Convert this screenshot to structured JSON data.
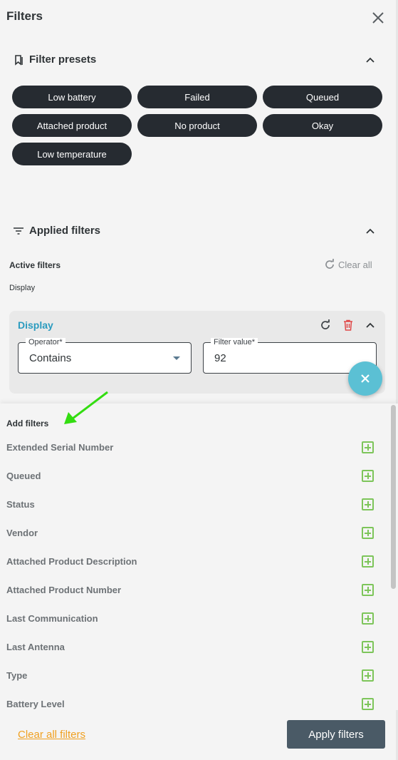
{
  "header": {
    "title": "Filters",
    "close_icon": "close-icon"
  },
  "presets": {
    "title": "Filter presets",
    "chips": [
      "Low battery",
      "Failed",
      "Queued",
      "Attached product",
      "No product",
      "Okay",
      "Low temperature"
    ]
  },
  "applied": {
    "title": "Applied filters",
    "active_label": "Active filters",
    "clear_all": "Clear all",
    "active_field": "Display",
    "card": {
      "title": "Display",
      "operator_label": "Operator*",
      "operator_value": "Contains",
      "value_label": "Filter value*",
      "value": "92"
    }
  },
  "add_filters": {
    "title": "Add filters",
    "items": [
      "Extended Serial Number",
      "Queued",
      "Status",
      "Vendor",
      "Attached Product Description",
      "Attached Product Number",
      "Last Communication",
      "Last Antenna",
      "Type",
      "Battery Level"
    ]
  },
  "footer": {
    "clear_filters": "Clear all filters",
    "apply": "Apply filters"
  },
  "colors": {
    "chip_bg": "#262b31",
    "accent_teal": "#2a9bbf",
    "fab": "#5bc0d4",
    "plus_green": "#7dc55a",
    "link_orange": "#f0a020",
    "apply_bg": "#4a5a66",
    "arrow_green": "#33dd11"
  }
}
